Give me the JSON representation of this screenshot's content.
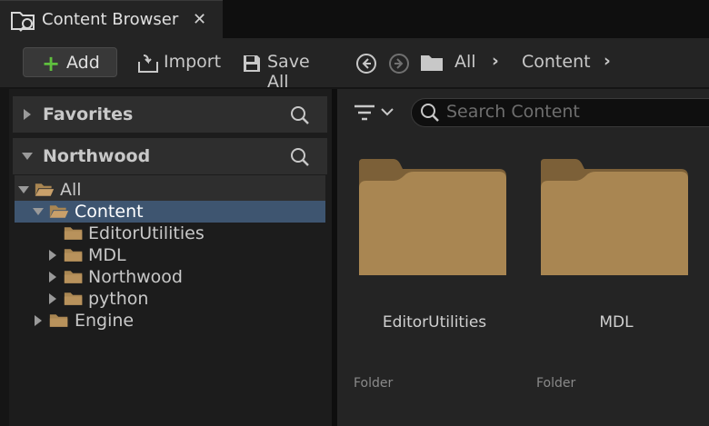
{
  "tab": {
    "title": "Content Browser",
    "close": "✕"
  },
  "toolbar": {
    "add_label": "Add",
    "import_label": "Import",
    "save_all_label": "Save All",
    "breadcrumb": [
      "All",
      "Content"
    ]
  },
  "left_panel": {
    "favorites_label": "Favorites",
    "project_label": "Northwood",
    "tree": [
      {
        "label": "All",
        "expanded": true,
        "selected": false
      },
      {
        "label": "Content",
        "expanded": true,
        "selected": true
      },
      {
        "label": "EditorUtilities",
        "expanded": false,
        "selected": false
      },
      {
        "label": "MDL",
        "expanded": false,
        "selected": false
      },
      {
        "label": "Northwood",
        "expanded": false,
        "selected": false
      },
      {
        "label": "python",
        "expanded": false,
        "selected": false
      },
      {
        "label": "Engine",
        "expanded": false,
        "selected": false
      }
    ]
  },
  "right_panel": {
    "search_placeholder": "Search Content",
    "items": [
      {
        "name": "EditorUtilities",
        "type": "Folder"
      },
      {
        "name": "MDL",
        "type": "Folder"
      }
    ]
  },
  "colors": {
    "folder": "#a98652",
    "selection": "#3e5570",
    "add_plus": "#5fbf3e"
  }
}
